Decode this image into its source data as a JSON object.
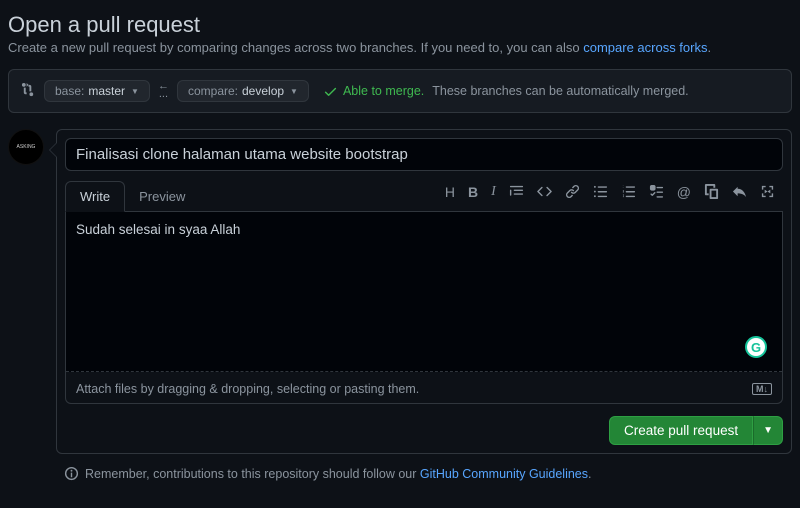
{
  "header": {
    "title": "Open a pull request",
    "subtitle_prefix": "Create a new pull request by comparing changes across two branches. If you need to, you can also ",
    "subtitle_link": "compare across forks",
    "subtitle_suffix": "."
  },
  "compare": {
    "base_label": "base:",
    "base_value": "master",
    "compare_label": "compare:",
    "compare_value": "develop",
    "separator": "...",
    "merge_status": "Able to merge.",
    "merge_note": "These branches can be automatically merged."
  },
  "pr": {
    "title_value": "Finalisasi clone halaman utama website bootstrap",
    "tabs": {
      "write": "Write",
      "preview": "Preview"
    },
    "body_value": "Sudah selesai in syaa Allah",
    "attach_hint": "Attach files by dragging & dropping, selecting or pasting them.",
    "submit_label": "Create pull request"
  },
  "footer": {
    "prefix": "Remember, contributions to this repository should follow our ",
    "link": "GitHub Community Guidelines",
    "suffix": "."
  },
  "toolbar_icons": [
    "heading",
    "bold",
    "italic",
    "quote",
    "code",
    "link",
    "ul",
    "ol",
    "tasklist",
    "mention",
    "crossref",
    "reply",
    "expand"
  ]
}
